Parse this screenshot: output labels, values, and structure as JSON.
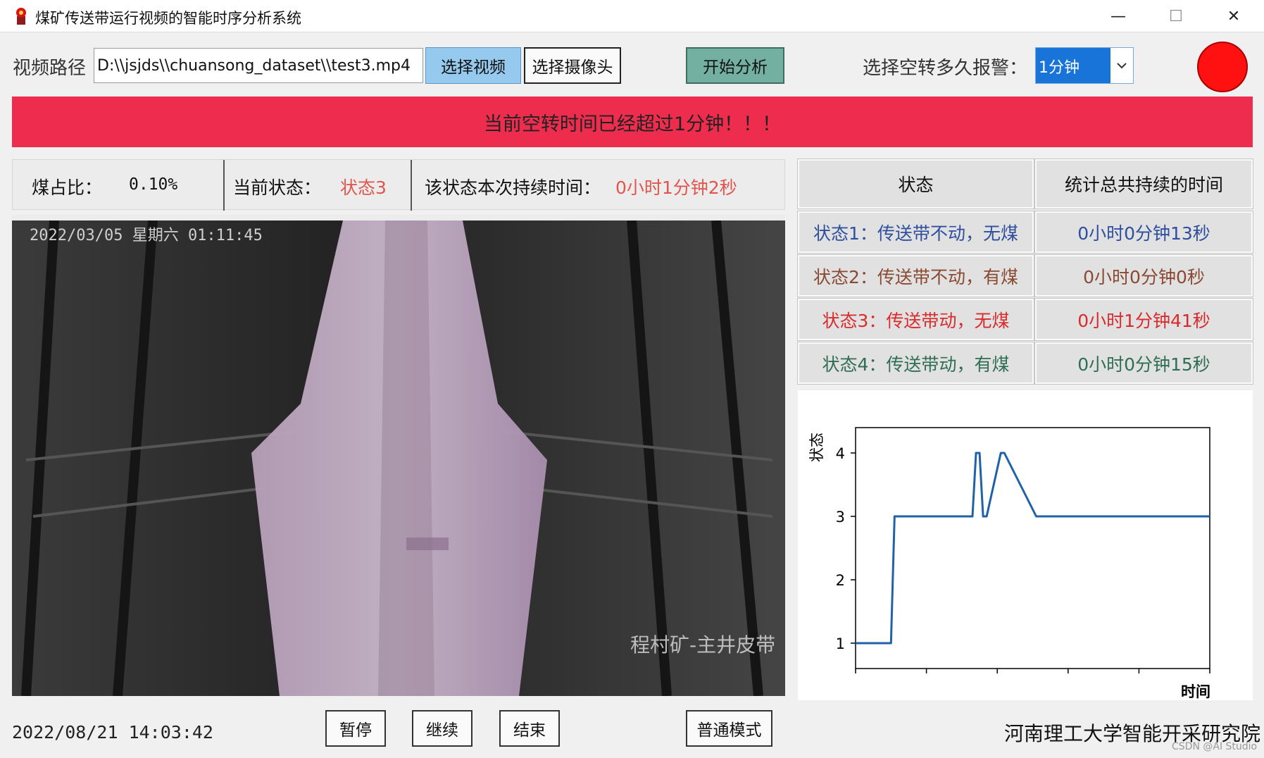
{
  "window": {
    "title": "煤矿传送带运行视频的智能时序分析系统",
    "controls": {
      "minimize": "—",
      "maximize": "☐",
      "close": "✕"
    }
  },
  "toolbar": {
    "path_label": "视频路径",
    "path_value": "D:\\\\jsjds\\\\chuansong_dataset\\\\test3.mp4",
    "select_video": "选择视频",
    "select_camera": "选择摄像头",
    "start_analysis": "开始分析",
    "alarm_label": "选择空转多久报警：",
    "alarm_value": "1分钟"
  },
  "alert": {
    "text": "当前空转时间已经超过1分钟！！！",
    "color": "#ee2d4e"
  },
  "info": {
    "coal_ratio_label": "煤占比：",
    "coal_ratio_value": "0.10%",
    "state_label": "当前状态：",
    "state_value": "状态3",
    "duration_label": "该状态本次持续时间：",
    "duration_value": "0小时1分钟2秒"
  },
  "video": {
    "timestamp": "2022/03/05 星期六 01:11:45",
    "caption": "程村矿-主井皮带"
  },
  "stats": {
    "headers": [
      "状态",
      "统计总共持续的时间"
    ],
    "rows": [
      {
        "state": "状态1：传送带不动，无煤",
        "time": "0小时0分钟13秒",
        "color": "#2e4f9e"
      },
      {
        "state": "状态2：传送带不动，有煤",
        "time": "0小时0分钟0秒",
        "color": "#8a4a32"
      },
      {
        "state": "状态3：传送带动，无煤",
        "time": "0小时1分钟41秒",
        "color": "#d92b2b"
      },
      {
        "state": "状态4：传送带动，有煤",
        "time": "0小时0分钟15秒",
        "color": "#2f6e55"
      }
    ]
  },
  "chart_data": {
    "type": "line",
    "ylabel": "状态",
    "xlabel": "时间",
    "yticks": [
      "1",
      "2",
      "3",
      "4"
    ],
    "ylim": [
      0.6,
      4.4
    ],
    "xlim": [
      0,
      100
    ],
    "color": "#1f62a8",
    "series": [
      {
        "x": [
          0,
          10,
          11,
          33,
          34,
          35,
          36,
          37,
          41,
          42,
          51,
          52,
          100
        ],
        "y": [
          1,
          1,
          3,
          3,
          4,
          4,
          3,
          3,
          4,
          4,
          3,
          3,
          3
        ]
      }
    ]
  },
  "bottom": {
    "datetime": "2022/08/21 14:03:42",
    "pause": "暂停",
    "resume": "继续",
    "end": "结束",
    "mode": "普通模式",
    "institute": "河南理工大学智能开采研究院",
    "watermark": "CSDN @AI Studio"
  }
}
